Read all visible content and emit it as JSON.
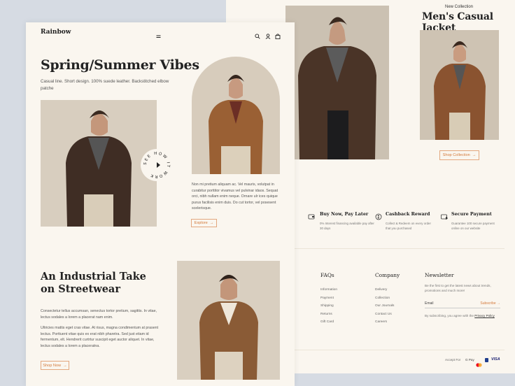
{
  "back": {
    "new_collection": "New Collection",
    "title": "Men's Casual Jacket",
    "shop_collection": "Shop Collection",
    "features": [
      {
        "title": "Buy Now, Pay Later",
        "desc": "0% Interest financing available pay after 30 days",
        "icon": "wallet-icon"
      },
      {
        "title": "Cashback Reward",
        "desc": "Collect & Redeem on every order that you purchased",
        "icon": "cashback-icon"
      },
      {
        "title": "Secure Payment",
        "desc": "Guarantee 100 secure payment online on our website",
        "icon": "secure-card-icon"
      }
    ],
    "faqs": {
      "heading": "FAQs",
      "links": [
        "Information",
        "Payment",
        "Shipping",
        "Returns",
        "Gift Card"
      ]
    },
    "company": {
      "heading": "Company",
      "links": [
        "Delivery",
        "Collection",
        "Our Journals",
        "Contact Us",
        "Careers"
      ]
    },
    "newsletter": {
      "heading": "Newsletter",
      "desc": "Be the first to get the latest news about trends, promotions and much more!",
      "email_placeholder": "Email",
      "subscribe": "Subscribe",
      "agree_prefix": "By subscribing, you agree with the",
      "privacy": "Privacy Policy"
    },
    "accept_for": "Accept For",
    "payments": [
      "G Pay",
      "VISA"
    ]
  },
  "front": {
    "logo": "Rainbow",
    "hero_title": "Spring/Summer Vibes",
    "hero_sub": "Casual line. Short design. 100% suede leather. Backstitched elbow patche",
    "badge": "SEE HOW IT WORK",
    "hero_para": "Non mi pretium aliquam ac. Vel mauris, volutpat in curabitur porttitor vivamus vel pulvinar idaos. Sequat orci, nibh nullam enim neque. Ornare ulr ices quique purus facilisis enim duis. Do cut tortor, vel posesent scelerisque.",
    "explore": "Explore",
    "section2_title": "An Industrial Take on Streetwear",
    "section2_para1": "Consectetur tellus accumsan, senectus tortor pretium, sagittis. In vitae, lectus sodales a lorem a placerat nam enim.",
    "section2_para2": "Ultricies mattis eget cras vitae. At risus, magna condimentum at prasent lectus. Porttuent vitae quis ex erat nibh pharetra. Sed just etiam id fermentum, elt. Hendrerit curtrtur suscipit eget auctor aliquet. In vitae, lectus sodales a lorem a placeratna.",
    "shop_now": "Shop Now"
  },
  "colors": {
    "accent": "#d3793a",
    "cream": "#faf6ef",
    "bg": "#d6dbe3",
    "text": "#222222"
  }
}
